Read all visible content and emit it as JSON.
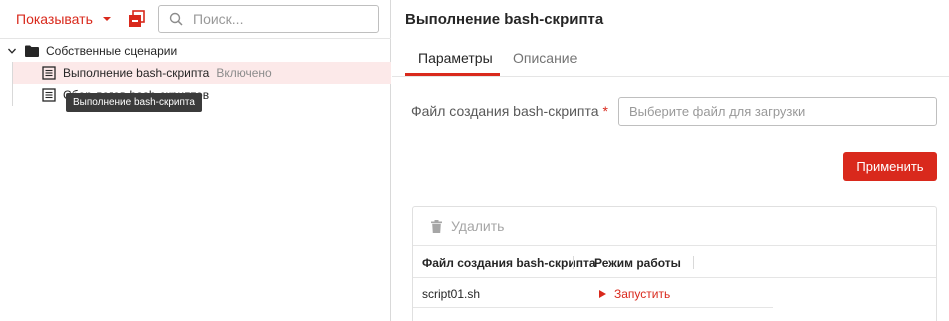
{
  "left": {
    "show_label": "Показывать",
    "search_placeholder": "Поиск...",
    "tree": {
      "folder_label": "Собственные сценарии",
      "items": [
        {
          "label": "Выполнение bash-скрипта",
          "status": "Включено"
        },
        {
          "label": "Сбор логов bash-скриптов"
        }
      ],
      "tooltip": "Выполнение bash-скрипта"
    }
  },
  "right": {
    "title": "Выполнение bash-скрипта",
    "tabs": [
      "Параметры",
      "Описание"
    ],
    "field_label": "Файл создания bash-скрипта",
    "required_mark": "*",
    "file_placeholder": "Выберите файл для загрузки",
    "apply_label": "Применить",
    "grid": {
      "delete_label": "Удалить",
      "columns": [
        "Файл создания bash-скрипта",
        "Режим работы"
      ],
      "rows": [
        {
          "file": "script01.sh",
          "action": "Запустить"
        }
      ]
    }
  },
  "colors": {
    "accent": "#d9291c",
    "selected_bg": "#fce9e9"
  }
}
